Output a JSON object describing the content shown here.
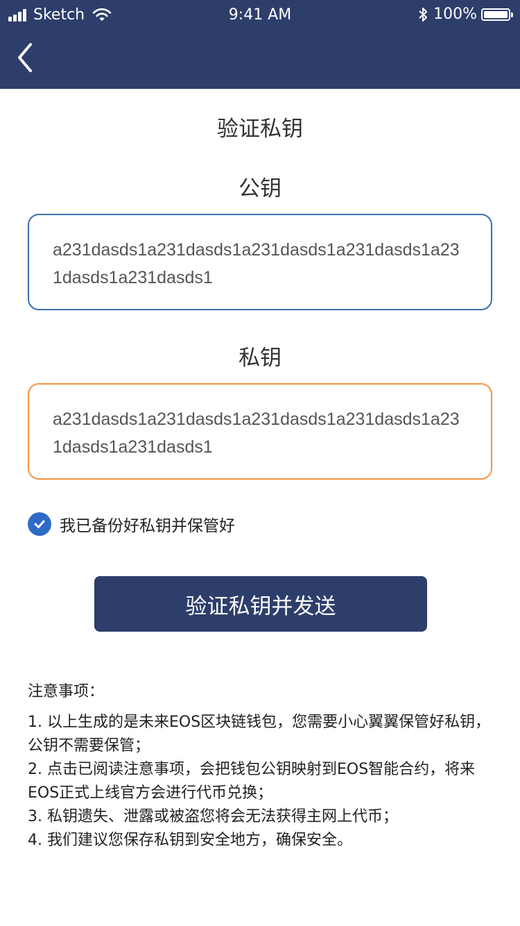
{
  "status_bar": {
    "carrier": "Sketch",
    "time": "9:41 AM",
    "battery": "100%"
  },
  "header": {
    "back_icon": "chevron-left-icon"
  },
  "page_title": "验证私钥",
  "public_key": {
    "label": "公钥",
    "value": "a231dasds1a231dasds1a231dasds1a231dasds1a231dasds1a231dasds1"
  },
  "private_key": {
    "label": "私钥",
    "value": "a231dasds1a231dasds1a231dasds1a231dasds1a231dasds1a231dasds1"
  },
  "confirm_checkbox": {
    "checked": true,
    "label": "我已备份好私钥并保管好"
  },
  "submit_button": {
    "label": "验证私钥并发送"
  },
  "notes": {
    "title": "注意事项：",
    "items": [
      "1. 以上生成的是未来EOS区块链钱包，您需要小心翼翼保管好私钥，公钥不需要保管；",
      "2. 点击已阅读注意事项，会把钱包公钥映射到EOS智能合约，将来EOS正式上线官方会进行代币兑换；",
      "3. 私钥遗失、泄露或被盗您将会无法获得主网上代币；",
      "4. 我们建议您保存私钥到安全地方，确保安全。"
    ]
  },
  "colors": {
    "header_bg": "#2e3e6b",
    "public_border": "#3b6db0",
    "private_border": "#f09545",
    "checkbox": "#2e6bc6",
    "button_bg": "#2e3e6b"
  }
}
